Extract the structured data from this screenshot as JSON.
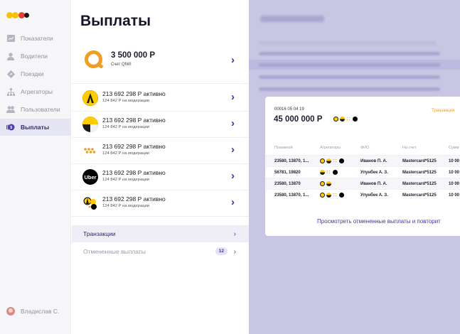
{
  "colors": {
    "accent": "#3b36a8",
    "orange": "#f39c22",
    "yellow": "#ffcc00"
  },
  "logo": {
    "dots": [
      "#f4c20d",
      "#f4c20d",
      "#e8412b"
    ]
  },
  "nav": {
    "items": [
      {
        "label": "Показатели",
        "icon": "chart-icon"
      },
      {
        "label": "Водители",
        "icon": "user-icon"
      },
      {
        "label": "Поездки",
        "icon": "route-icon"
      },
      {
        "label": "Агрегаторы",
        "icon": "hierarchy-icon"
      },
      {
        "label": "Пользователи",
        "icon": "users-icon"
      },
      {
        "label": "Выплаты",
        "icon": "payout-icon",
        "active": true
      }
    ],
    "user": "Владислав С."
  },
  "main": {
    "title": "Выплаты",
    "qiwi": {
      "amount": "3 500 000 Р",
      "sub": "Счет QIWI"
    },
    "aggregators": [
      {
        "name": "yandex",
        "amount": "213 692 298 Р активно",
        "sub": "124 842 Р на модерации"
      },
      {
        "name": "citymobil",
        "amount": "213 692 298 Р активно",
        "sub": "124 842 Р на модерации"
      },
      {
        "name": "didi",
        "amount": "213 692 298 Р активно",
        "sub": "124 842 Р на модерации"
      },
      {
        "name": "uber",
        "logo_text": "Uber",
        "amount": "213 692 298 Р активно",
        "sub": "124 842 Р на модерации"
      },
      {
        "name": "multi",
        "amount": "213 692 298 Р активно",
        "sub": "124 842 Р на модерации"
      }
    ],
    "sections": [
      {
        "label": "Транзакции",
        "active": true
      },
      {
        "label": "Отмененные выплаты",
        "badge": "12"
      }
    ]
  },
  "detail": {
    "id_date": "00016  05 04 19",
    "amount": "45 000 000 Р",
    "link": "Транзакция",
    "headers": [
      "Позывной",
      "Агрегаторы",
      "ФИО",
      "На счет",
      "Сумм"
    ],
    "rows": [
      {
        "callsign": "23580, 13870, 1...",
        "name": "Иванов П. А.",
        "account": "Mastercard*5125",
        "sum": "10 00",
        "icons": [
          "yandex",
          "citymobil",
          "didi",
          "uber"
        ]
      },
      {
        "callsign": "56781, 19820",
        "name": "Улунбек А. З.",
        "account": "Mastercard*5125",
        "sum": "10 00",
        "icons": [
          "citymobil",
          "didi",
          "uber"
        ]
      },
      {
        "callsign": "23580, 13870",
        "name": "Иванов П. А.",
        "account": "Mastercard*5125",
        "sum": "10 00",
        "icons": [
          "yandex",
          "citymobil"
        ]
      },
      {
        "callsign": "23580, 13870, 1...",
        "name": "Улунбек А. З.",
        "account": "Mastercard*5125",
        "sum": "10 00",
        "icons": [
          "yandex",
          "citymobil",
          "didi",
          "uber"
        ]
      }
    ],
    "footer": "Просмотреть отмененные выплаты и повторит"
  }
}
